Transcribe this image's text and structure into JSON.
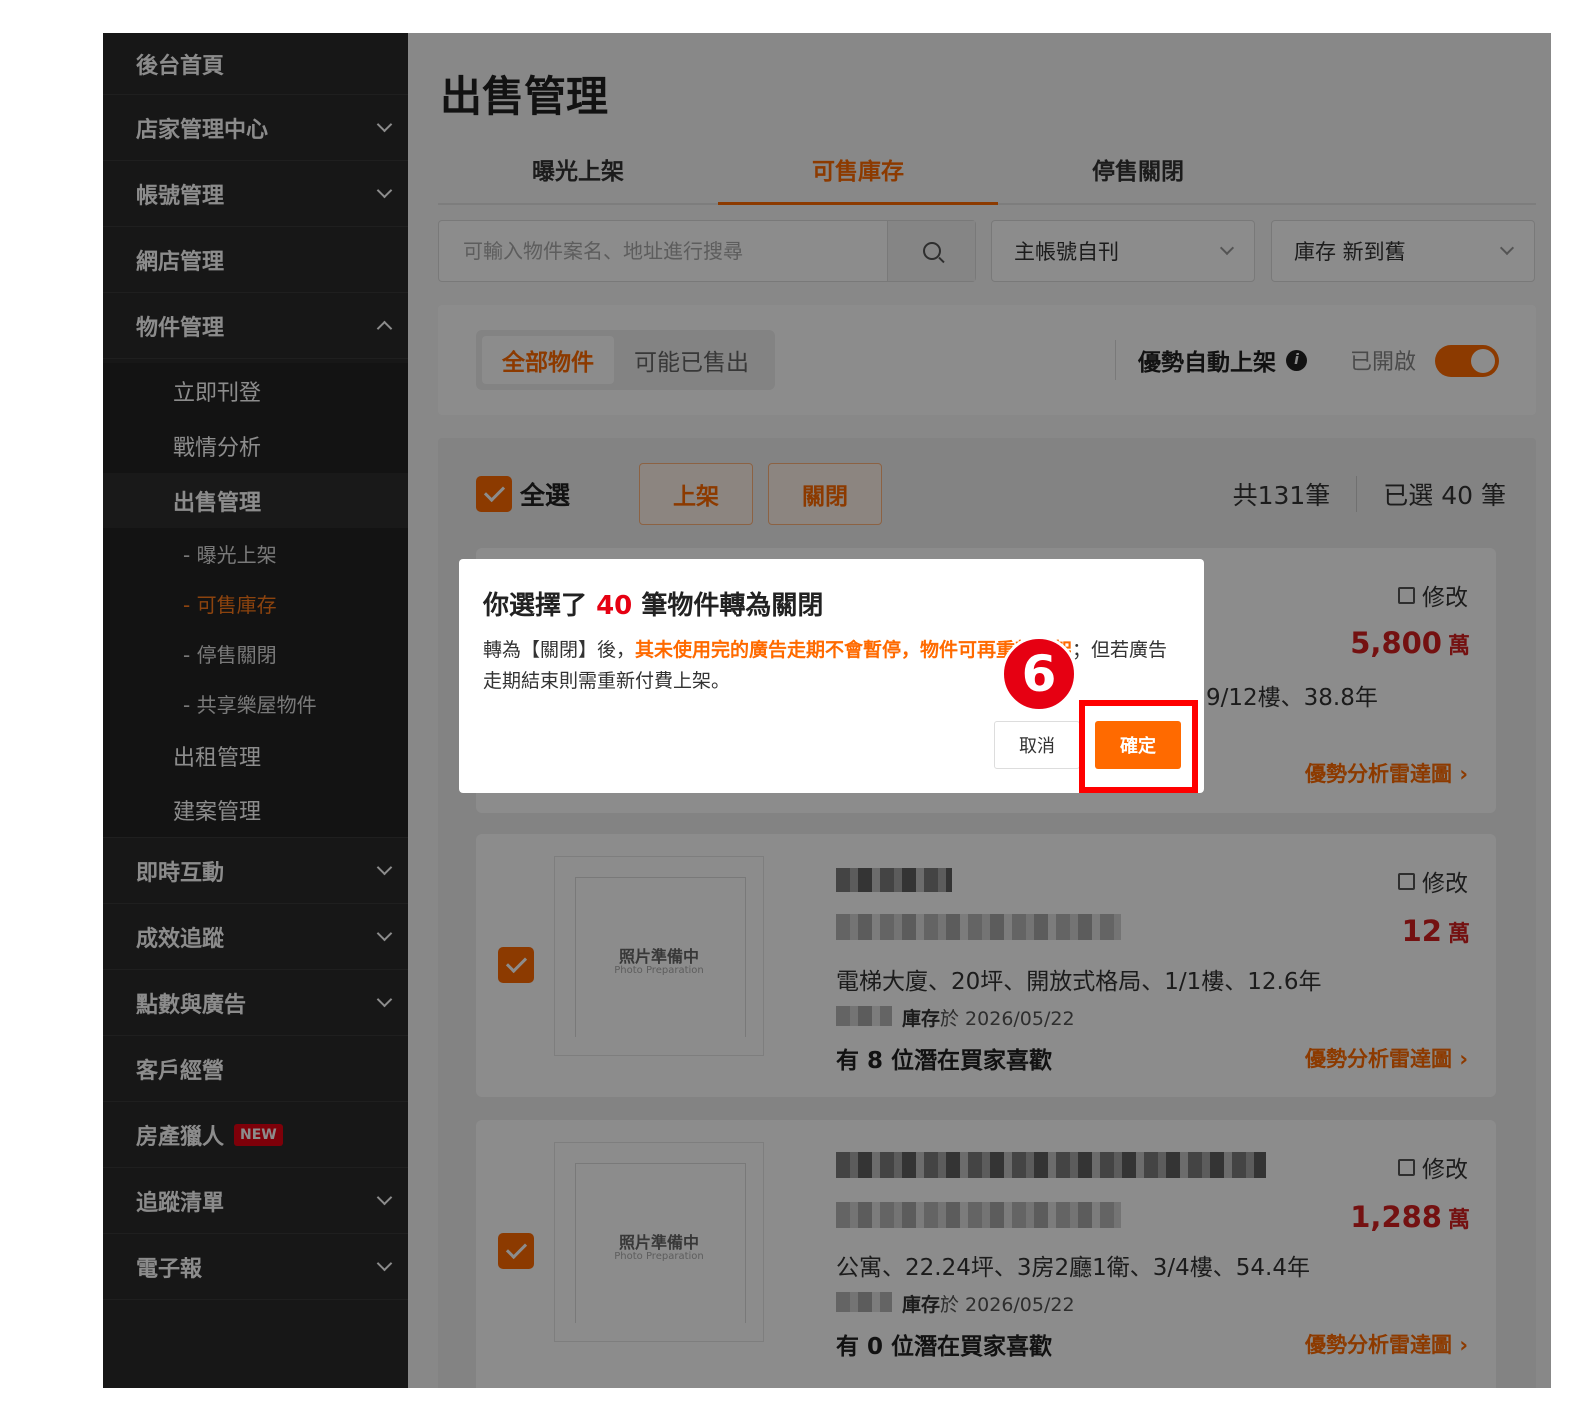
{
  "sidebar": {
    "items": [
      {
        "label": "後台首頁"
      },
      {
        "label": "店家管理中心"
      },
      {
        "label": "帳號管理"
      },
      {
        "label": "網店管理"
      },
      {
        "label": "物件管理"
      }
    ],
    "sub_items": [
      "立即刊登",
      "戰情分析",
      "出售管理",
      "出租管理",
      "建案管理"
    ],
    "sale_sub": [
      "- 曝光上架",
      "- 可售庫存",
      "- 停售關閉",
      "- 共享樂屋物件"
    ],
    "bottom_items": [
      {
        "label": "即時互動"
      },
      {
        "label": "成效追蹤"
      },
      {
        "label": "點數與廣告"
      },
      {
        "label": "客戶經營"
      },
      {
        "label": "房產獵人",
        "badge": "NEW"
      },
      {
        "label": "追蹤清單"
      },
      {
        "label": "電子報"
      }
    ]
  },
  "main": {
    "title": "出售管理",
    "tabs": [
      "曝光上架",
      "可售庫存",
      "停售關閉"
    ],
    "search_placeholder": "可輸入物件案名、地址進行搜尋",
    "select_account": "主帳號自刊",
    "select_sort": "庫存 新到舊",
    "segments": [
      "全部物件",
      "可能已售出"
    ],
    "auto_label": "優勢自動上架",
    "auto_status": "已開啟",
    "select_all": "全選",
    "btn_publish": "上架",
    "btn_close": "關閉",
    "total": "共131筆",
    "selected": "已選 40 筆"
  },
  "listings": [
    {
      "edit": "修改",
      "price": "5,800",
      "unit": "萬",
      "spec": "9/12樓、38.8年",
      "radar": "優勢分析雷達圖 ›"
    },
    {
      "edit": "修改",
      "price": "12",
      "unit": "萬",
      "placeholder": "照片準備中",
      "placeholder_en": "Photo Preparation",
      "spec": "電梯大廈、20坪、開放式格局、1/1樓、12.6年",
      "stock_label": "庫存",
      "stock_date": "於 2026/05/22",
      "likes": "有 8 位潛在買家喜歡",
      "radar": "優勢分析雷達圖 ›"
    },
    {
      "edit": "修改",
      "price": "1,288",
      "unit": "萬",
      "placeholder": "照片準備中",
      "placeholder_en": "Photo Preparation",
      "spec": "公寓、22.24坪、3房2廳1衛、3/4樓、54.4年",
      "stock_label": "庫存",
      "stock_date": "於 2026/05/22",
      "likes": "有 0 位潛在買家喜歡",
      "radar": "優勢分析雷達圖 ›"
    }
  ],
  "dialog": {
    "title_pre": "你選擇了",
    "title_num": "40",
    "title_post": "筆物件轉為關閉",
    "body_pre": "轉為【關閉】後，",
    "body_hl": "其未使用完的廣告走期不會暫停，物件可再重新上架",
    "body_post": "；但若廣告走期結束則需重新付費上架。",
    "cancel": "取消",
    "confirm": "確定",
    "step": "6"
  },
  "colors": {
    "accent": "#ff6a00",
    "highlight": "#ff0000",
    "price": "#d42020"
  }
}
